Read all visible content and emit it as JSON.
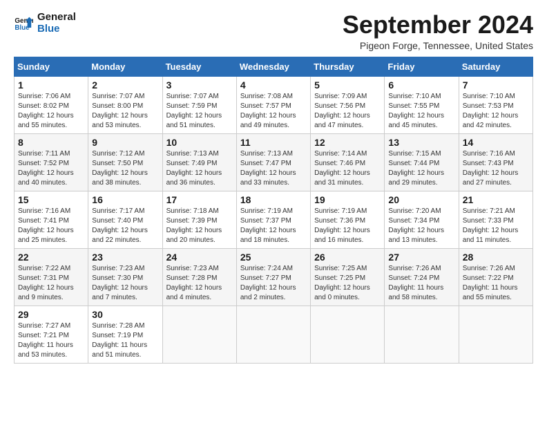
{
  "header": {
    "logo_line1": "General",
    "logo_line2": "Blue",
    "month_title": "September 2024",
    "location": "Pigeon Forge, Tennessee, United States"
  },
  "weekdays": [
    "Sunday",
    "Monday",
    "Tuesday",
    "Wednesday",
    "Thursday",
    "Friday",
    "Saturday"
  ],
  "weeks": [
    [
      {
        "day": "1",
        "info": "Sunrise: 7:06 AM\nSunset: 8:02 PM\nDaylight: 12 hours\nand 55 minutes."
      },
      {
        "day": "2",
        "info": "Sunrise: 7:07 AM\nSunset: 8:00 PM\nDaylight: 12 hours\nand 53 minutes."
      },
      {
        "day": "3",
        "info": "Sunrise: 7:07 AM\nSunset: 7:59 PM\nDaylight: 12 hours\nand 51 minutes."
      },
      {
        "day": "4",
        "info": "Sunrise: 7:08 AM\nSunset: 7:57 PM\nDaylight: 12 hours\nand 49 minutes."
      },
      {
        "day": "5",
        "info": "Sunrise: 7:09 AM\nSunset: 7:56 PM\nDaylight: 12 hours\nand 47 minutes."
      },
      {
        "day": "6",
        "info": "Sunrise: 7:10 AM\nSunset: 7:55 PM\nDaylight: 12 hours\nand 45 minutes."
      },
      {
        "day": "7",
        "info": "Sunrise: 7:10 AM\nSunset: 7:53 PM\nDaylight: 12 hours\nand 42 minutes."
      }
    ],
    [
      {
        "day": "8",
        "info": "Sunrise: 7:11 AM\nSunset: 7:52 PM\nDaylight: 12 hours\nand 40 minutes."
      },
      {
        "day": "9",
        "info": "Sunrise: 7:12 AM\nSunset: 7:50 PM\nDaylight: 12 hours\nand 38 minutes."
      },
      {
        "day": "10",
        "info": "Sunrise: 7:13 AM\nSunset: 7:49 PM\nDaylight: 12 hours\nand 36 minutes."
      },
      {
        "day": "11",
        "info": "Sunrise: 7:13 AM\nSunset: 7:47 PM\nDaylight: 12 hours\nand 33 minutes."
      },
      {
        "day": "12",
        "info": "Sunrise: 7:14 AM\nSunset: 7:46 PM\nDaylight: 12 hours\nand 31 minutes."
      },
      {
        "day": "13",
        "info": "Sunrise: 7:15 AM\nSunset: 7:44 PM\nDaylight: 12 hours\nand 29 minutes."
      },
      {
        "day": "14",
        "info": "Sunrise: 7:16 AM\nSunset: 7:43 PM\nDaylight: 12 hours\nand 27 minutes."
      }
    ],
    [
      {
        "day": "15",
        "info": "Sunrise: 7:16 AM\nSunset: 7:41 PM\nDaylight: 12 hours\nand 25 minutes."
      },
      {
        "day": "16",
        "info": "Sunrise: 7:17 AM\nSunset: 7:40 PM\nDaylight: 12 hours\nand 22 minutes."
      },
      {
        "day": "17",
        "info": "Sunrise: 7:18 AM\nSunset: 7:39 PM\nDaylight: 12 hours\nand 20 minutes."
      },
      {
        "day": "18",
        "info": "Sunrise: 7:19 AM\nSunset: 7:37 PM\nDaylight: 12 hours\nand 18 minutes."
      },
      {
        "day": "19",
        "info": "Sunrise: 7:19 AM\nSunset: 7:36 PM\nDaylight: 12 hours\nand 16 minutes."
      },
      {
        "day": "20",
        "info": "Sunrise: 7:20 AM\nSunset: 7:34 PM\nDaylight: 12 hours\nand 13 minutes."
      },
      {
        "day": "21",
        "info": "Sunrise: 7:21 AM\nSunset: 7:33 PM\nDaylight: 12 hours\nand 11 minutes."
      }
    ],
    [
      {
        "day": "22",
        "info": "Sunrise: 7:22 AM\nSunset: 7:31 PM\nDaylight: 12 hours\nand 9 minutes."
      },
      {
        "day": "23",
        "info": "Sunrise: 7:23 AM\nSunset: 7:30 PM\nDaylight: 12 hours\nand 7 minutes."
      },
      {
        "day": "24",
        "info": "Sunrise: 7:23 AM\nSunset: 7:28 PM\nDaylight: 12 hours\nand 4 minutes."
      },
      {
        "day": "25",
        "info": "Sunrise: 7:24 AM\nSunset: 7:27 PM\nDaylight: 12 hours\nand 2 minutes."
      },
      {
        "day": "26",
        "info": "Sunrise: 7:25 AM\nSunset: 7:25 PM\nDaylight: 12 hours\nand 0 minutes."
      },
      {
        "day": "27",
        "info": "Sunrise: 7:26 AM\nSunset: 7:24 PM\nDaylight: 11 hours\nand 58 minutes."
      },
      {
        "day": "28",
        "info": "Sunrise: 7:26 AM\nSunset: 7:22 PM\nDaylight: 11 hours\nand 55 minutes."
      }
    ],
    [
      {
        "day": "29",
        "info": "Sunrise: 7:27 AM\nSunset: 7:21 PM\nDaylight: 11 hours\nand 53 minutes."
      },
      {
        "day": "30",
        "info": "Sunrise: 7:28 AM\nSunset: 7:19 PM\nDaylight: 11 hours\nand 51 minutes."
      },
      {
        "day": "",
        "info": ""
      },
      {
        "day": "",
        "info": ""
      },
      {
        "day": "",
        "info": ""
      },
      {
        "day": "",
        "info": ""
      },
      {
        "day": "",
        "info": ""
      }
    ]
  ]
}
